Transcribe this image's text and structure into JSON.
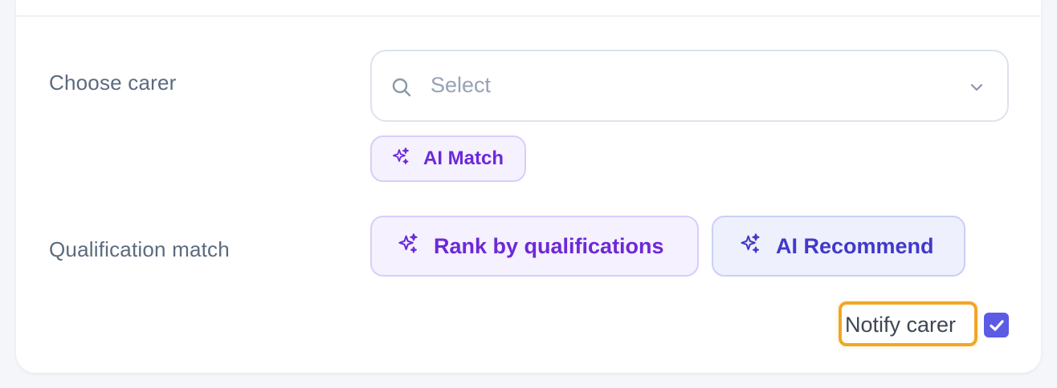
{
  "form": {
    "choose_carer": {
      "label": "Choose carer",
      "select_placeholder": "Select",
      "search_icon": "search-icon",
      "chevron_icon": "chevron-down-icon",
      "ai_match_label": "AI Match"
    },
    "qualification_match": {
      "label": "Qualification match",
      "rank_button_label": "Rank by qualifications",
      "recommend_button_label": "AI Recommend",
      "sparkle_icon": "sparkle-icon"
    },
    "notify": {
      "label": "Notify carer",
      "checked": true
    }
  },
  "colors": {
    "violet_accent": "#6d28d9",
    "indigo_accent": "#4338ca",
    "checkbox": "#5b5be6",
    "highlight_outline": "#f0a626"
  }
}
